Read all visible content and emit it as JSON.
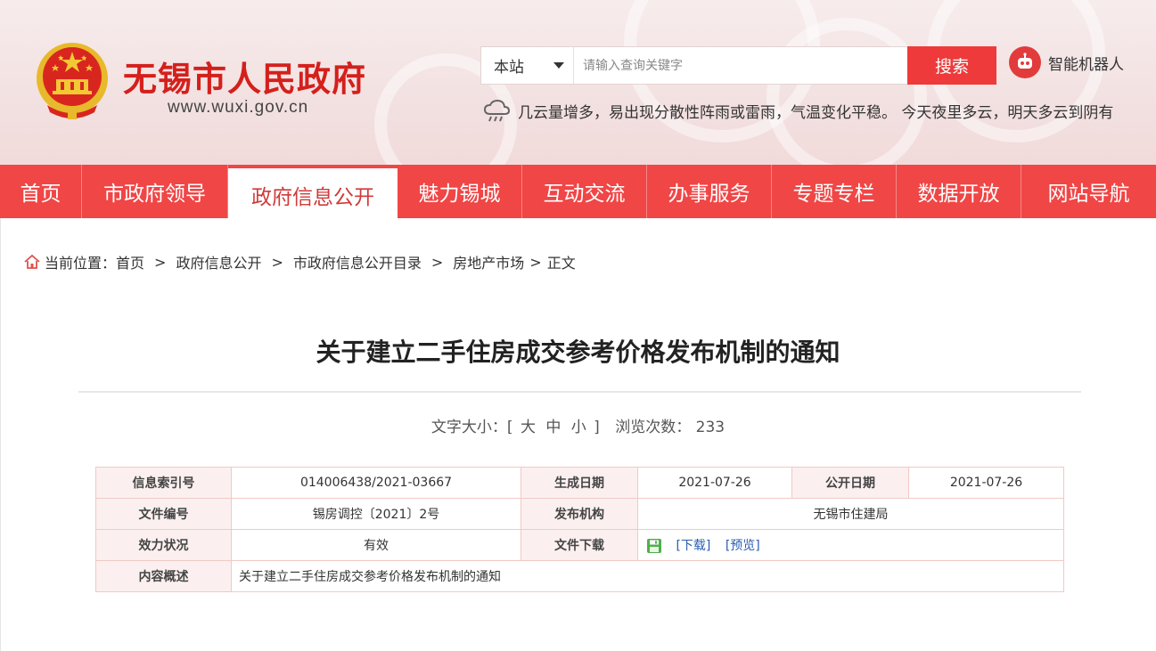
{
  "header": {
    "site_name": "无锡市人民政府",
    "site_url": "www.wuxi.gov.cn",
    "search": {
      "scope": "本站",
      "placeholder": "请输入查询关键字",
      "button": "搜索"
    },
    "robot_label": "智能机器人",
    "weather_text": "几云量增多，易出现分散性阵雨或雷雨，气温变化平稳。 今天夜里多云，明天多云到阴有"
  },
  "nav": {
    "items": [
      {
        "label": "首页"
      },
      {
        "label": "市政府领导"
      },
      {
        "label": "政府信息公开"
      },
      {
        "label": "魅力锡城"
      },
      {
        "label": "互动交流"
      },
      {
        "label": "办事服务"
      },
      {
        "label": "专题专栏"
      },
      {
        "label": "数据开放"
      },
      {
        "label": "网站导航"
      }
    ],
    "active_index": 2
  },
  "breadcrumb": {
    "prefix": "当前位置：",
    "items": [
      "首页",
      "政府信息公开",
      "市政府信息公开目录",
      "房地产市场",
      "正文"
    ]
  },
  "article": {
    "title": "关于建立二手住房成交参考价格发布机制的通知",
    "font_size_label": "文字大小：[",
    "font_sizes": [
      "大",
      "中",
      "小"
    ],
    "font_size_close": "]",
    "views_label": "浏览次数：",
    "views": "233"
  },
  "info": {
    "index_no_label": "信息索引号",
    "index_no": "014006438/2021-03667",
    "created_label": "生成日期",
    "created": "2021-07-26",
    "published_label": "公开日期",
    "published": "2021-07-26",
    "doc_no_label": "文件编号",
    "doc_no": "锡房调控〔2021〕2号",
    "issuer_label": "发布机构",
    "issuer": "无锡市住建局",
    "status_label": "效力状况",
    "status": "有效",
    "download_label": "文件下载",
    "download_link": "[下载]",
    "preview_link": "[预览]",
    "summary_label": "内容概述",
    "summary": "关于建立二手住房成交参考价格发布机制的通知"
  },
  "colors": {
    "brand_red": "#d4201c",
    "nav_red": "#f04646",
    "table_border": "#f1c9c4",
    "link_blue": "#2a5db0"
  }
}
